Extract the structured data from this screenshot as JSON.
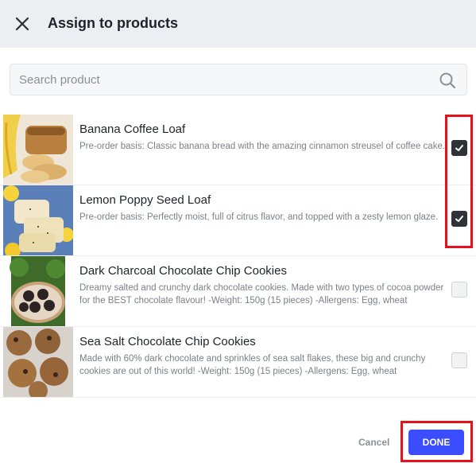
{
  "dialog": {
    "title": "Assign to products"
  },
  "search": {
    "placeholder": "Search product",
    "value": ""
  },
  "products": [
    {
      "name": "Banana Coffee Loaf",
      "description": "Pre-order basis: Classic banana bread with the amazing cinnamon streusel of coffee cake.",
      "checked": true
    },
    {
      "name": "Lemon Poppy Seed Loaf",
      "description": "Pre-order basis: Perfectly moist, full of citrus flavor, and topped with a zesty lemon glaze.",
      "checked": true
    },
    {
      "name": "Dark Charcoal Chocolate Chip Cookies",
      "description": "Dreamy salted and crunchy dark chocolate cookies. Made with two types of cocoa powder for the BEST chocolate flavour! -Weight: 150g (15 pieces) -Allergens: Egg, wheat",
      "checked": false
    },
    {
      "name": "Sea Salt Chocolate Chip Cookies",
      "description": "Made with 60% dark chocolate and sprinkles of sea salt flakes, these big and crunchy cookies are out of this world! -Weight: 150g (15 pieces) -Allergens: Egg, wheat",
      "checked": false
    }
  ],
  "footer": {
    "cancel_label": "Cancel",
    "done_label": "DONE"
  },
  "colors": {
    "primary": "#3c4dff",
    "highlight": "#e5121b",
    "checked": "#2f3337"
  }
}
